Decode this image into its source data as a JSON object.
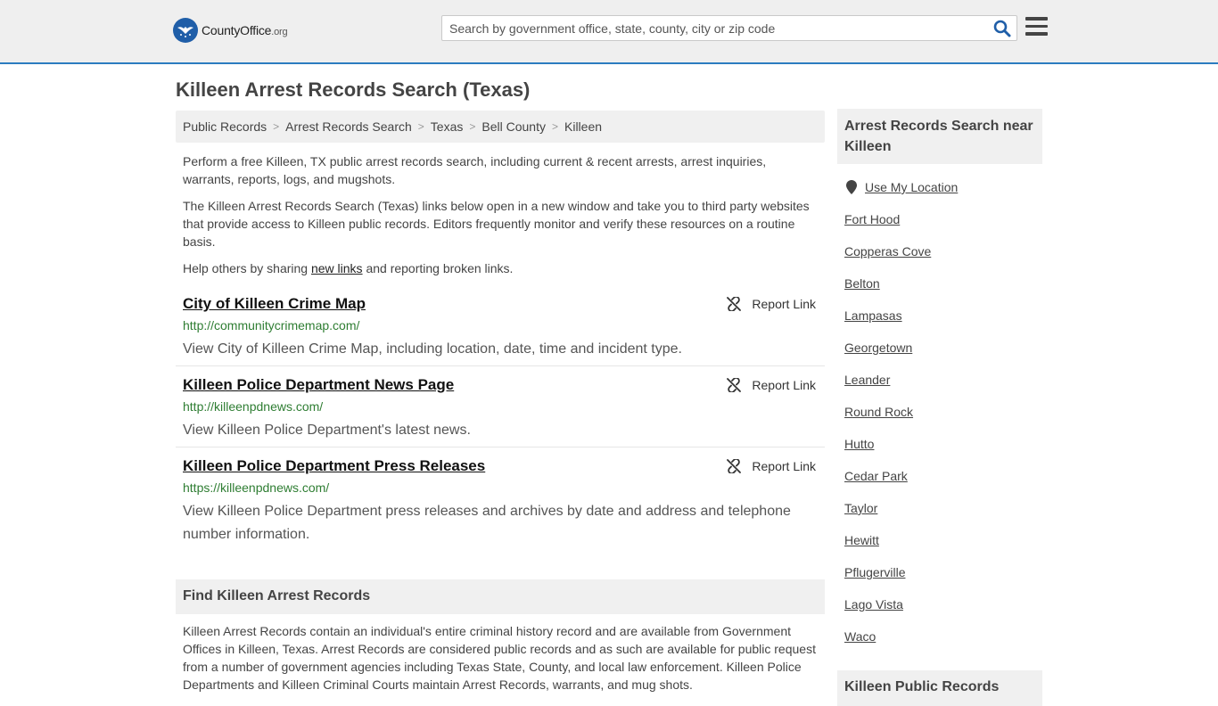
{
  "header": {
    "logo_main": "CountyOffice",
    "logo_suffix": ".org",
    "search_placeholder": "Search by government office, state, county, city or zip code"
  },
  "page_title": "Killeen Arrest Records Search (Texas)",
  "breadcrumb": [
    "Public Records",
    "Arrest Records Search",
    "Texas",
    "Bell County",
    "Killeen"
  ],
  "intro": {
    "p1": "Perform a free Killeen, TX public arrest records search, including current & recent arrests, arrest inquiries, warrants, reports, logs, and mugshots.",
    "p2": "The Killeen Arrest Records Search (Texas) links below open in a new window and take you to third party websites that provide access to Killeen public records. Editors frequently monitor and verify these resources on a routine basis.",
    "p3_before": "Help others by sharing ",
    "p3_link": "new links",
    "p3_after": " and reporting broken links."
  },
  "links": [
    {
      "title": "City of Killeen Crime Map",
      "url": "http://communitycrimemap.com/",
      "desc": "View City of Killeen Crime Map, including location, date, time and incident type.",
      "report": "Report Link"
    },
    {
      "title": "Killeen Police Department News Page",
      "url": "http://killeenpdnews.com/",
      "desc": "View Killeen Police Department's latest news.",
      "report": "Report Link"
    },
    {
      "title": "Killeen Police Department Press Releases",
      "url": "https://killeenpdnews.com/",
      "desc": "View Killeen Police Department press releases and archives by date and address and telephone number information.",
      "report": "Report Link"
    }
  ],
  "find_section": {
    "heading": "Find Killeen Arrest Records",
    "body": "Killeen Arrest Records contain an individual's entire criminal history record and are available from Government Offices in Killeen, Texas. Arrest Records are considered public records and as such are available for public request from a number of government agencies including Texas State, County, and local law enforcement. Killeen Police Departments and Killeen Criminal Courts maintain Arrest Records, warrants, and mug shots."
  },
  "sidebar": {
    "heading": "Arrest Records Search near Killeen",
    "use_location": "Use My Location",
    "cities": [
      "Fort Hood",
      "Copperas Cove",
      "Belton",
      "Lampasas",
      "Georgetown",
      "Leander",
      "Round Rock",
      "Hutto",
      "Cedar Park",
      "Taylor",
      "Hewitt",
      "Pflugerville",
      "Lago Vista",
      "Waco"
    ],
    "heading2": "Killeen Public Records"
  },
  "colors": {
    "accent_blue": "#2c7cc0",
    "url_green": "#2e7d32",
    "logo_blue": "#1f5ea8"
  }
}
